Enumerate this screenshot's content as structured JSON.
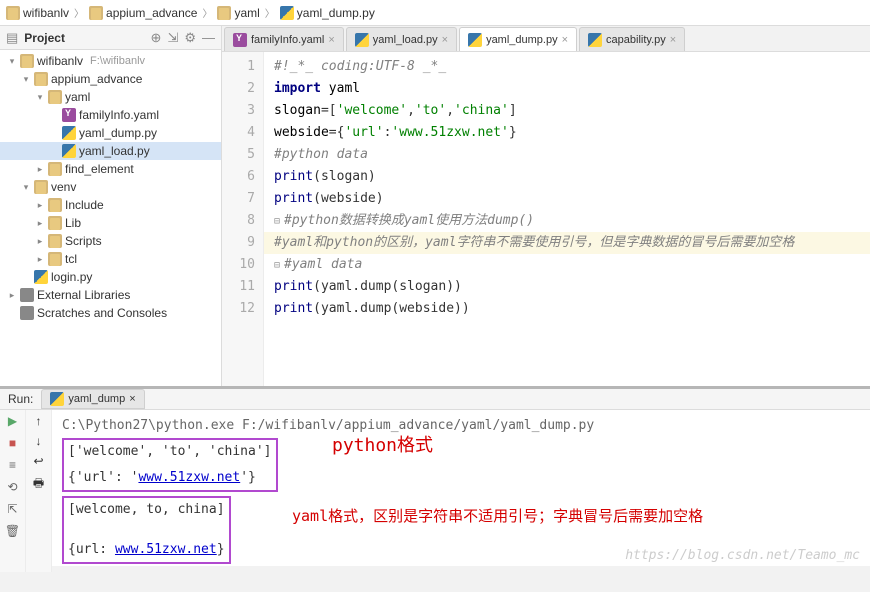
{
  "breadcrumbs": [
    {
      "icon": "folder",
      "label": "wifibanlv"
    },
    {
      "icon": "folder",
      "label": "appium_advance"
    },
    {
      "icon": "folder",
      "label": "yaml"
    },
    {
      "icon": "py",
      "label": "yaml_dump.py"
    }
  ],
  "project": {
    "title": "Project",
    "tree": [
      {
        "depth": 0,
        "arrow": "▾",
        "icon": "folder",
        "label": "wifibanlv",
        "gray": "F:\\wifibanlv"
      },
      {
        "depth": 1,
        "arrow": "▾",
        "icon": "folder",
        "label": "appium_advance"
      },
      {
        "depth": 2,
        "arrow": "▾",
        "icon": "folder",
        "label": "yaml"
      },
      {
        "depth": 3,
        "arrow": "",
        "icon": "yaml",
        "label": "familyInfo.yaml"
      },
      {
        "depth": 3,
        "arrow": "",
        "icon": "py",
        "label": "yaml_dump.py"
      },
      {
        "depth": 3,
        "arrow": "",
        "icon": "py",
        "label": "yaml_load.py",
        "selected": true
      },
      {
        "depth": 2,
        "arrow": "▸",
        "icon": "folder",
        "label": "find_element"
      },
      {
        "depth": 1,
        "arrow": "▾",
        "icon": "folder",
        "label": "venv"
      },
      {
        "depth": 2,
        "arrow": "▸",
        "icon": "folder",
        "label": "Include"
      },
      {
        "depth": 2,
        "arrow": "▸",
        "icon": "folder",
        "label": "Lib"
      },
      {
        "depth": 2,
        "arrow": "▸",
        "icon": "folder",
        "label": "Scripts"
      },
      {
        "depth": 2,
        "arrow": "▸",
        "icon": "folder",
        "label": "tcl"
      },
      {
        "depth": 1,
        "arrow": "",
        "icon": "py",
        "label": "login.py"
      },
      {
        "depth": 0,
        "arrow": "▸",
        "icon": "lib",
        "label": "External Libraries"
      },
      {
        "depth": 0,
        "arrow": "",
        "icon": "lib",
        "label": "Scratches and Consoles"
      }
    ]
  },
  "tabs": [
    {
      "icon": "yaml",
      "label": "familyInfo.yaml"
    },
    {
      "icon": "py",
      "label": "yaml_load.py"
    },
    {
      "icon": "py",
      "label": "yaml_dump.py",
      "active": true
    },
    {
      "icon": "py",
      "label": "capability.py"
    }
  ],
  "code": {
    "lines": [
      {
        "n": 1,
        "html": "<span class='cmt'>#!_*_ coding:UTF-8 _*_</span>"
      },
      {
        "n": 2,
        "html": "<span class='kw'>import</span> <span class='id'>yaml</span>"
      },
      {
        "n": 3,
        "html": "<span class='id'>slogan</span>=[<span class='str'>'welcome'</span>,<span class='str'>'to'</span>,<span class='str'>'china'</span>]"
      },
      {
        "n": 4,
        "html": "<span class='id'>webside</span>={<span class='str'>'url'</span>:<span class='str'>'www.51zxw.net'</span>}"
      },
      {
        "n": 5,
        "html": "<span class='cmt'>#python data</span>"
      },
      {
        "n": 6,
        "html": "<span class='builtin'>print</span>(slogan)"
      },
      {
        "n": 7,
        "html": "<span class='builtin'>print</span>(webside)"
      },
      {
        "n": 8,
        "html": "<span class='fold'>⊟</span><span class='cmt'>#python数据转换成yaml使用方法dump()</span>"
      },
      {
        "n": 9,
        "hl": true,
        "html": "<span class='cmt'>#yaml和python的区别，yaml字符串不需要使用引号，但是字典数据的冒号后需要加空格</span>"
      },
      {
        "n": 10,
        "html": "<span class='fold'>⊟</span><span class='cmt'>#yaml data</span>"
      },
      {
        "n": 11,
        "html": "<span class='builtin'>print</span>(yaml.dump(slogan))"
      },
      {
        "n": 12,
        "html": "<span class='builtin'>print</span>(yaml.dump(webside))"
      }
    ]
  },
  "run": {
    "title": "Run:",
    "tab": "yaml_dump",
    "cmd": "C:\\Python27\\python.exe F:/wifibanlv/appium_advance/yaml/yaml_dump.py",
    "block1_line1": "['welcome', 'to', 'china']",
    "block1_line2a": "{'url': '",
    "block1_link": "www.51zxw.net",
    "block1_line2b": "'}",
    "block2_line1": "[welcome, to, china]",
    "block2_line2a": "{url: ",
    "block2_link": "www.51zxw.net",
    "block2_line2b": "}",
    "note1": "python格式",
    "note2": "yaml格式，区别是字符串不适用引号；字典冒号后需要加空格",
    "watermark": "https://blog.csdn.net/Teamo_mc"
  }
}
